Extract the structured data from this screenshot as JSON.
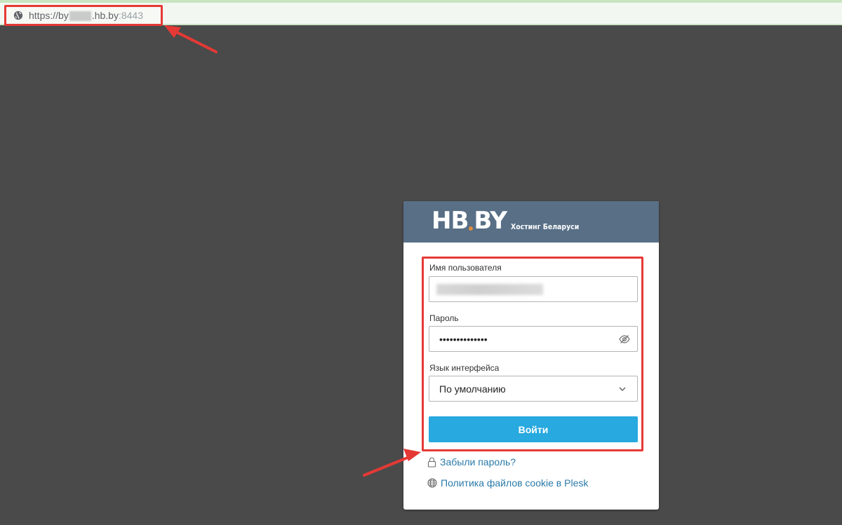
{
  "browser": {
    "url_prefix": "https://by",
    "url_domain": ".hb.by",
    "url_port": ":8443",
    "icon": "globe-icon"
  },
  "brand": {
    "logo_left": "HB",
    "logo_right": "BY",
    "tagline": "Хостинг Беларуси",
    "header_color": "#586f86",
    "dot_color": "#e08a3c"
  },
  "form": {
    "username": {
      "label": "Имя пользователя"
    },
    "password": {
      "label": "Пароль",
      "value": "••••••••••••••",
      "toggle_icon": "eye-slash-icon"
    },
    "language": {
      "label": "Язык интерфейса",
      "selected": "По умолчанию",
      "icon": "chevron-down-icon"
    },
    "submit_label": "Войти",
    "button_color": "#28a9df"
  },
  "links": {
    "forgot_password": {
      "label": "Забыли пароль?",
      "icon": "lock-icon"
    },
    "cookie_policy": {
      "label": "Политика файлов cookie в Plesk",
      "icon": "globe-icon"
    }
  },
  "annotations": {
    "highlight_color": "#e53935"
  }
}
